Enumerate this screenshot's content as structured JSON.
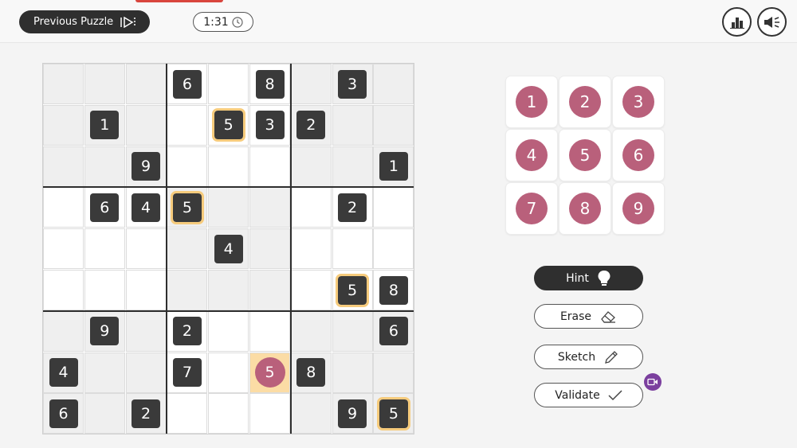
{
  "header": {
    "prev_label": "Previous Puzzle",
    "timer": "1:31",
    "icons": [
      "skip-icon",
      "clock-icon",
      "stats-icon",
      "sound-icon"
    ]
  },
  "board": {
    "grid": [
      [
        "",
        "",
        "",
        "6",
        "",
        "8",
        "",
        "3",
        ""
      ],
      [
        "",
        "1",
        "",
        "",
        "5",
        "3",
        "2",
        "",
        ""
      ],
      [
        "",
        "",
        "9",
        "",
        "",
        "",
        "",
        "",
        "1"
      ],
      [
        "",
        "6",
        "4",
        "5",
        "",
        "",
        "",
        "2",
        ""
      ],
      [
        "",
        "",
        "",
        "",
        "4",
        "",
        "",
        "",
        ""
      ],
      [
        "",
        "",
        "",
        "",
        "",
        "",
        "",
        "5",
        "8"
      ],
      [
        "",
        "9",
        "",
        "2",
        "",
        "",
        "",
        "",
        "6"
      ],
      [
        "4",
        "",
        "",
        "7",
        "",
        "5",
        "8",
        "",
        ""
      ],
      [
        "6",
        "",
        "2",
        "",
        "",
        "",
        "",
        "9",
        "5"
      ]
    ],
    "highlighted": [
      "1-4",
      "3-3",
      "5-7",
      "8-8"
    ],
    "selected": "7-5"
  },
  "pad": {
    "numbers": [
      "1",
      "2",
      "3",
      "4",
      "5",
      "6",
      "7",
      "8",
      "9"
    ]
  },
  "actions": {
    "hint": "Hint",
    "erase": "Erase",
    "sketch": "Sketch",
    "validate": "Validate"
  },
  "colors": {
    "accent": "#b9607b",
    "highlight": "#f6cb7c",
    "tile": "#3a3a3a",
    "badge": "#7b3f9e"
  }
}
